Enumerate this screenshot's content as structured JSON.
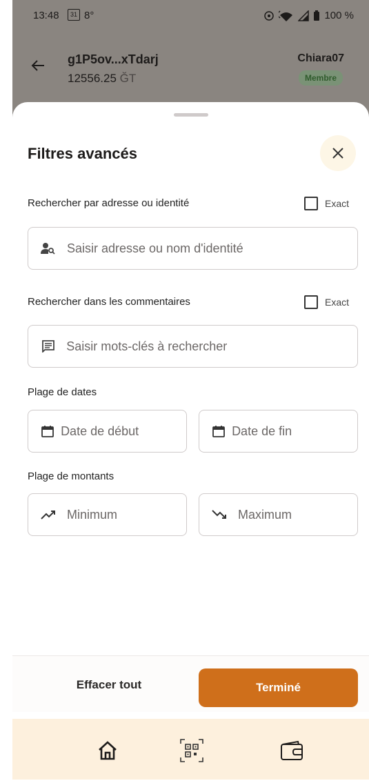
{
  "status_bar": {
    "time": "13:48",
    "calendar_day": "31",
    "temperature": "8°",
    "battery": "100 %"
  },
  "header": {
    "account_name": "g1P5ov...xTdarj",
    "balance": "12556.25",
    "currency": "ĞT",
    "user_name": "Chiara07",
    "badge": "Membre"
  },
  "sheet": {
    "title": "Filtres avancés",
    "address_search": {
      "label": "Rechercher par adresse ou identité",
      "exact_label": "Exact",
      "placeholder": "Saisir adresse ou nom d'identité"
    },
    "comment_search": {
      "label": "Rechercher dans les commentaires",
      "exact_label": "Exact",
      "placeholder": "Saisir mots-clés à rechercher"
    },
    "date_range": {
      "label": "Plage de dates",
      "start_placeholder": "Date de début",
      "end_placeholder": "Date de fin"
    },
    "amount_range": {
      "label": "Plage de montants",
      "min_placeholder": "Minimum",
      "max_placeholder": "Maximum"
    },
    "clear_label": "Effacer tout",
    "done_label": "Terminé"
  },
  "nav": {
    "items": [
      "home-icon",
      "qr-code-icon",
      "wallet-icon"
    ]
  },
  "colors": {
    "accent": "#cf6f1b",
    "nav_bg": "#fdf0dd",
    "badge_bg": "#7a9276"
  }
}
